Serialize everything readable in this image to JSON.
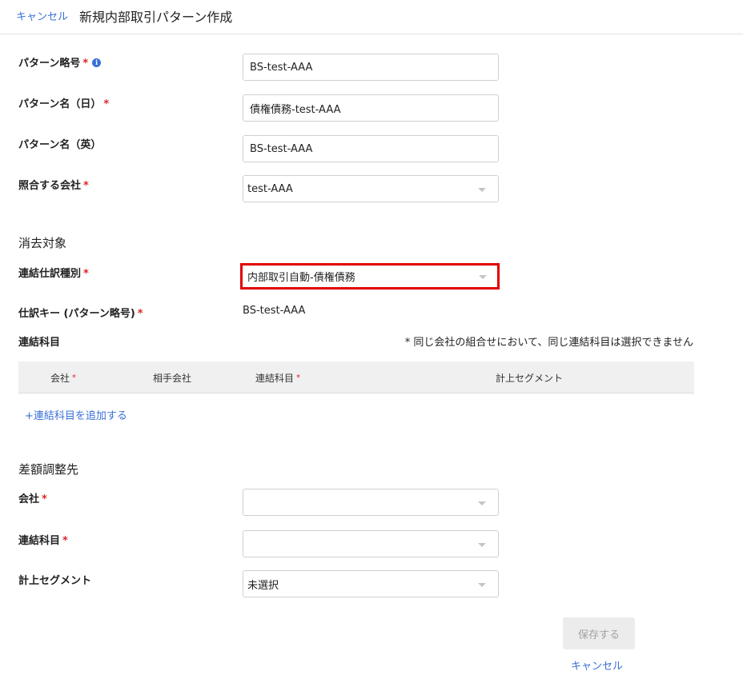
{
  "header": {
    "cancel_label": "キャンセル",
    "title": "新規内部取引パターン作成"
  },
  "form": {
    "pattern_code": {
      "label": "パターン略号",
      "value": "BS-test-AAA",
      "required": true,
      "info_icon": "info-icon"
    },
    "pattern_name_ja": {
      "label": "パターン名（日）",
      "value": "債権債務-test-AAA",
      "required": true
    },
    "pattern_name_en": {
      "label": "パターン名（英）",
      "value": "BS-test-AAA",
      "required": false
    },
    "matching_company": {
      "label": "照合する会社",
      "value": "test-AAA",
      "required": true
    }
  },
  "elimination": {
    "section_title": "消去対象",
    "journal_type": {
      "label": "連結仕訳種別",
      "value": "内部取引自動-債権債務",
      "required": true
    },
    "journal_key": {
      "label": "仕訳キー (パターン略号)",
      "value": "BS-test-AAA",
      "required": true
    },
    "accounts": {
      "label": "連結科目",
      "note": "* 同じ会社の組合せにおいて、同じ連結科目は選択できません",
      "columns": [
        {
          "label": "会社",
          "required": true
        },
        {
          "label": "相手会社",
          "required": false
        },
        {
          "label": "連結科目",
          "required": true
        },
        {
          "label": "計上セグメント",
          "required": false
        }
      ],
      "add_label": "+連結科目を追加する"
    }
  },
  "difference": {
    "section_title": "差額調整先",
    "company": {
      "label": "会社",
      "value": "",
      "required": true
    },
    "account": {
      "label": "連結科目",
      "value": "",
      "required": true
    },
    "segment": {
      "label": "計上セグメント",
      "value": "未選択",
      "required": false
    }
  },
  "footer": {
    "save_label": "保存する",
    "cancel_label": "キャンセル"
  },
  "colors": {
    "link": "#3a6fd8",
    "required": "#d9262c",
    "highlight": "#e00000"
  }
}
